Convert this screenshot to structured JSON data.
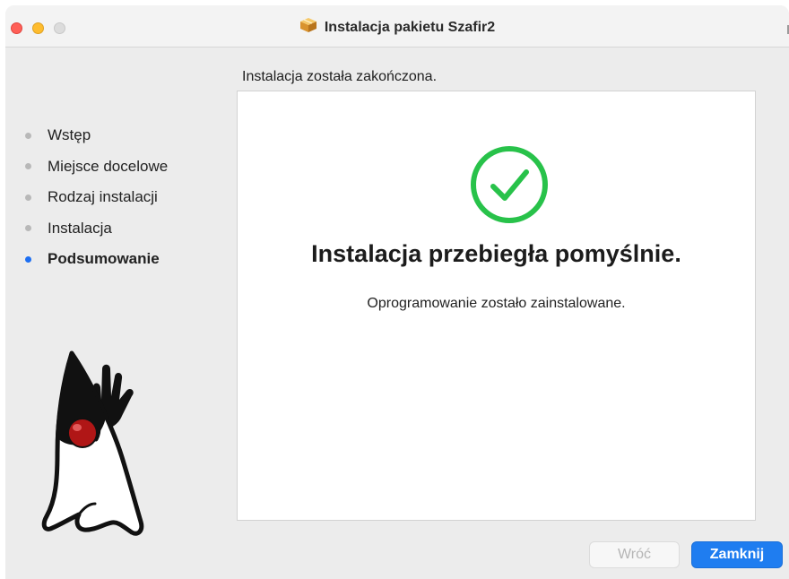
{
  "window": {
    "title": "Instalacja pakietu Szafir2",
    "title_icon": "package-box-icon"
  },
  "sidebar": {
    "items": [
      {
        "label": "Wstęp",
        "active": false
      },
      {
        "label": "Miejsce docelowe",
        "active": false
      },
      {
        "label": "Rodzaj instalacji",
        "active": false
      },
      {
        "label": "Instalacja",
        "active": false
      },
      {
        "label": "Podsumowanie",
        "active": true
      }
    ]
  },
  "main": {
    "header": "Instalacja została zakończona.",
    "headline": "Instalacja przebiegła pomyślnie.",
    "subtext": "Oprogramowanie zostało zainstalowane.",
    "status_icon": "checkmark-circle-icon"
  },
  "buttons": {
    "back_label": "Wróć",
    "close_label": "Zamknij"
  },
  "colors": {
    "accent": "#1f7df0",
    "success": "#28c24a",
    "close": "#ff5f57",
    "minimize": "#febc2e",
    "zoom": "#dcdcdc"
  }
}
